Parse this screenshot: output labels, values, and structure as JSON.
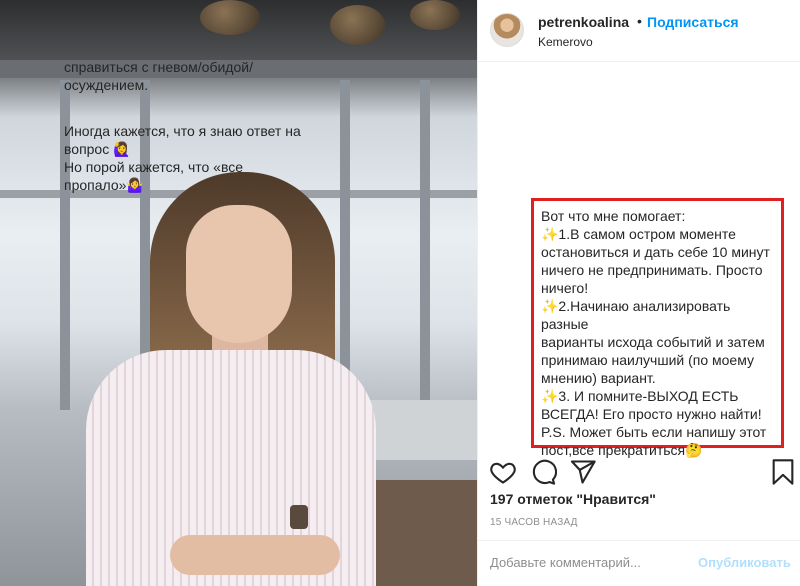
{
  "header": {
    "username": "petrenkoalina",
    "separator": "•",
    "follow_label": "Подписаться",
    "location": "Kemerovo"
  },
  "caption": {
    "top_lines": [
      "справиться с гневом/обидой/",
      "осуждением.",
      "",
      "Иногда кажется, что я знаю ответ на",
      "вопрос 🙋‍♀",
      "Но порой кажется, что «все",
      "пропало»🤷‍♀"
    ],
    "highlighted_lines": [
      "Вот что мне помогает:",
      "✨1.В самом остром моменте",
      "остановиться и дать себе 10 минут",
      "ничего не предпринимать. Просто",
      "ничего!",
      "✨2.Начинаю анализировать разные",
      "варианты исхода событий и затем",
      "принимаю наилучший (по моему",
      "мнению) вариант.",
      "✨3. И помните-ВЫХОД ЕСТЬ",
      "ВСЕГДА! Его просто нужно найти!",
      "P.S. Может быть если напишу этот",
      "пост,все прекратиться🤔"
    ]
  },
  "actions": {
    "like_icon": "heart-icon",
    "comment_icon": "comment-icon",
    "share_icon": "share-icon",
    "save_icon": "bookmark-icon"
  },
  "likes_text": "197 отметок \"Нравится\"",
  "timestamp": "15 ЧАСОВ НАЗАД",
  "comment": {
    "placeholder": "Добавьте комментарий...",
    "post_label": "Опубликовать"
  },
  "colors": {
    "accent": "#0095f6",
    "highlight_border": "#e02020",
    "muted": "#8e8e8e"
  }
}
